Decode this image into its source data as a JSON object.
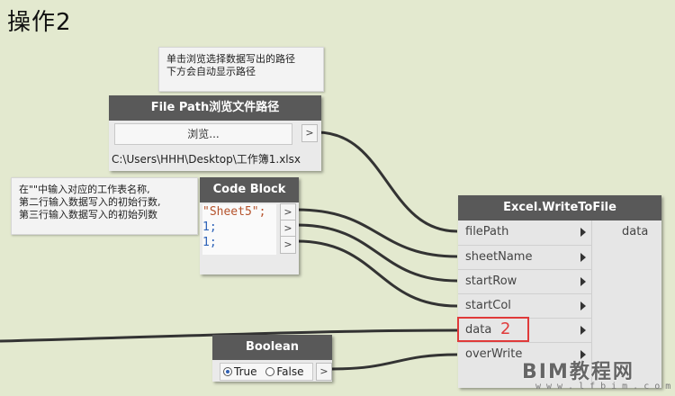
{
  "title": "操作2",
  "notes": {
    "path_note": "单击浏览选择数据写出的路径\n下方会自动显示路径",
    "codeblock_note": "在\"\"中输入对应的工作表名称,\n第二行输入数据写入的初始行数,\n第三行输入数据写入的初始列数"
  },
  "file_path_node": {
    "title": "File Path浏览文件路径",
    "browse_label": "浏览...",
    "output_port": ">",
    "path_value": "C:\\Users\\HHH\\Desktop\\工作簿1.xlsx"
  },
  "code_block_node": {
    "title": "Code Block",
    "lines": [
      "\"Sheet5\";",
      "1;",
      "1;"
    ],
    "ports": [
      ">",
      ">",
      ">"
    ]
  },
  "excel_node": {
    "title": "Excel.WriteToFile",
    "inputs": [
      "filePath",
      "sheetName",
      "startRow",
      "startCol",
      "data",
      "overWrite"
    ],
    "output": "data"
  },
  "annotation": {
    "number": "2",
    "color": "#e03a3a"
  },
  "boolean_node": {
    "title": "Boolean",
    "true_label": "True",
    "false_label": "False",
    "selected": "True",
    "output_port": ">"
  },
  "watermark": {
    "main": "BIM教程网",
    "sub": "www.lfbim.com"
  },
  "colors": {
    "canvas": "#e3e9cf",
    "node_header": "#595959",
    "wire": "#333333"
  }
}
